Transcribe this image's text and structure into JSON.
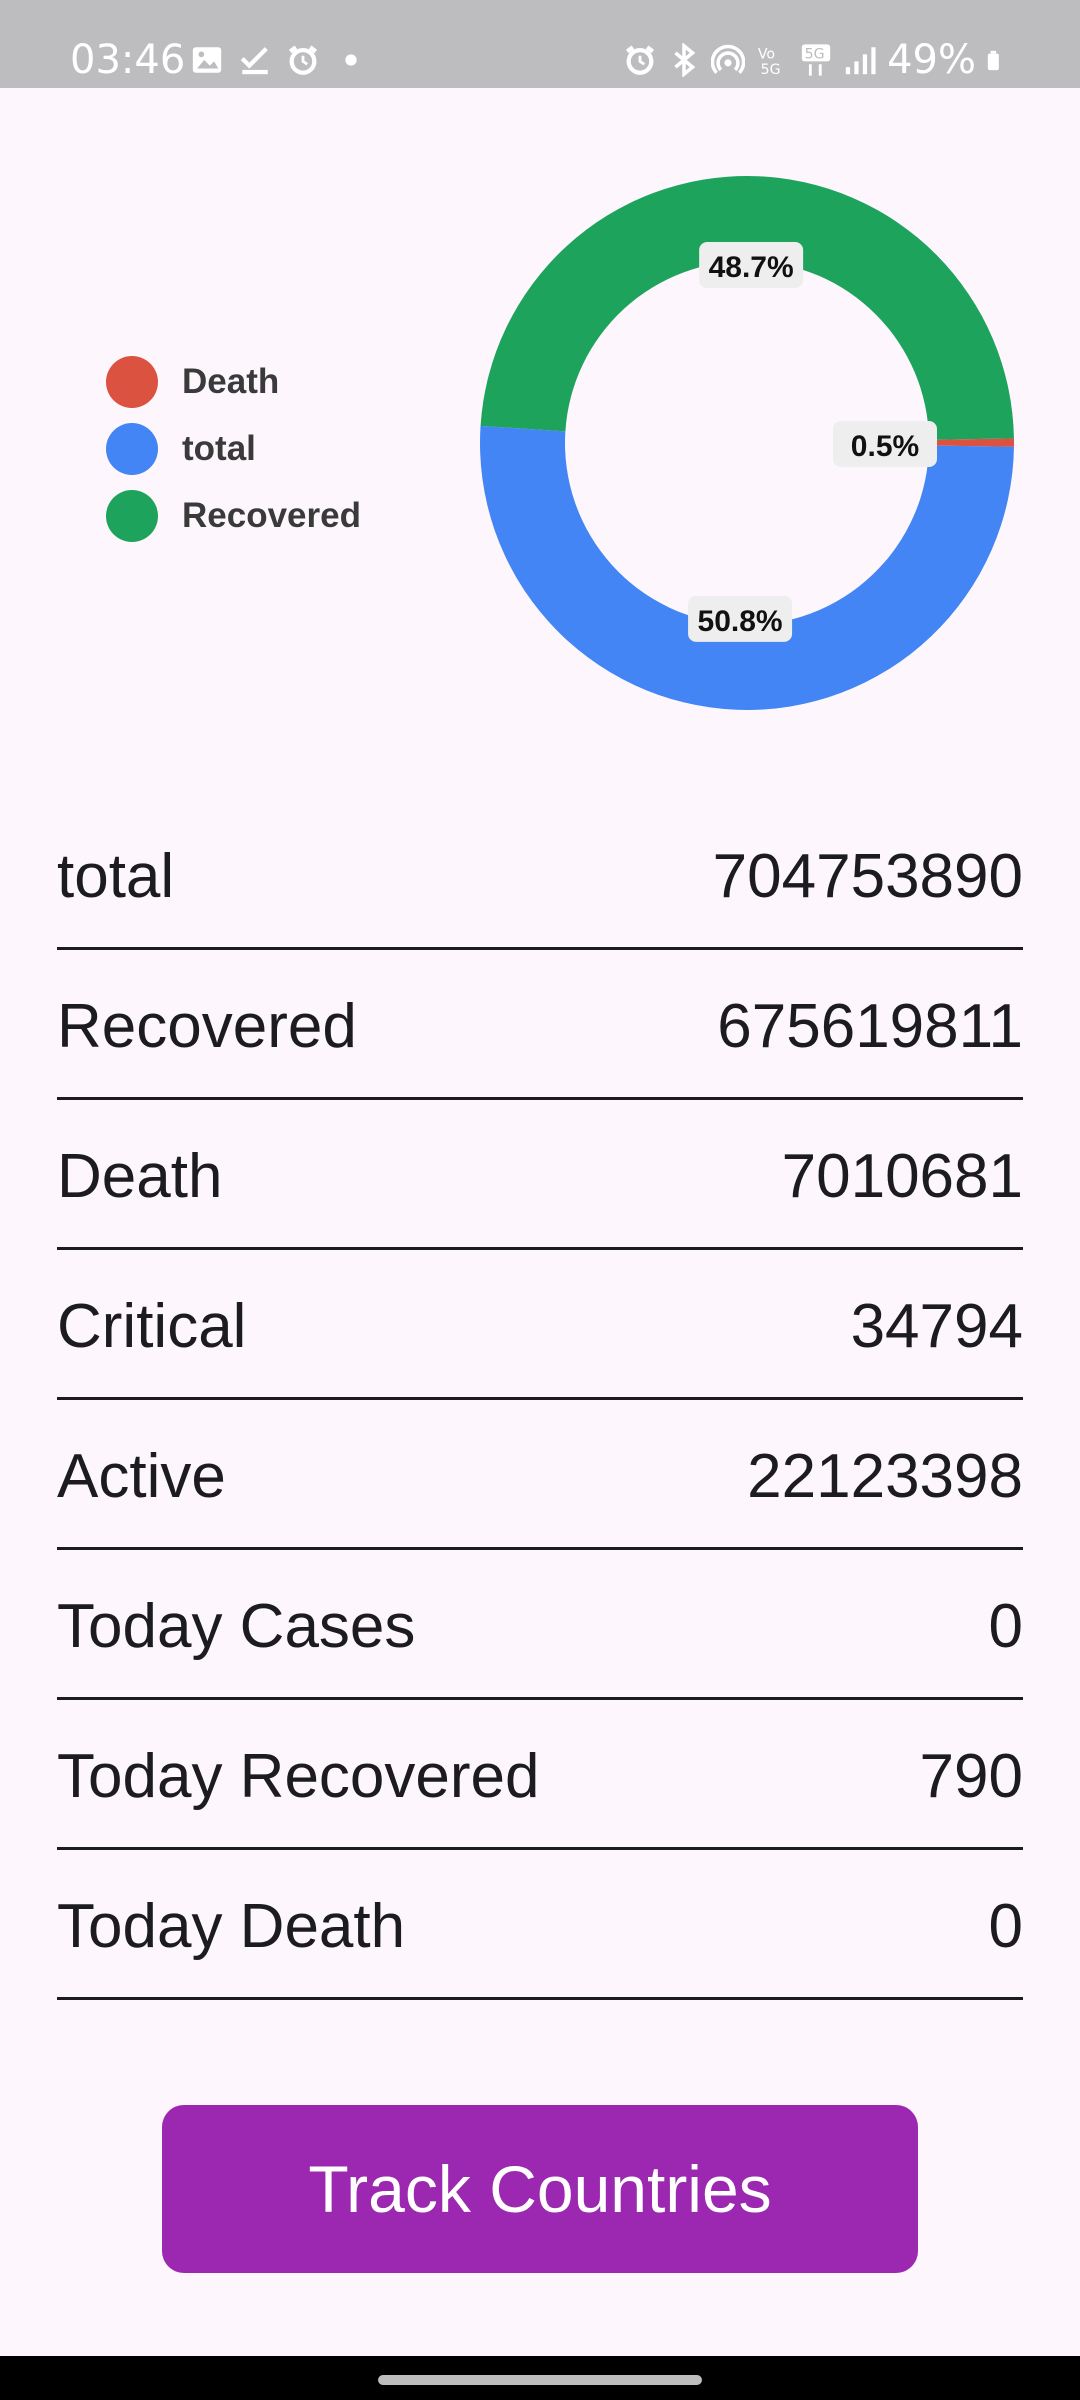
{
  "status_bar": {
    "time": "03:46",
    "battery": "49%",
    "left_icons": [
      "image-icon",
      "check-icon",
      "alarm-icon",
      "dot-icon"
    ],
    "right_icons": [
      "alarm-icon",
      "bluetooth-icon",
      "hotspot-icon",
      "volte-icon",
      "5g-icon",
      "signal-icon",
      "battery-icon"
    ]
  },
  "chart_data": {
    "type": "pie",
    "donut": true,
    "legend_position": "left",
    "series": [
      {
        "name": "Death",
        "value": 0.5,
        "label": "0.5%",
        "color": "#dc5241"
      },
      {
        "name": "total",
        "value": 50.8,
        "label": "50.8%",
        "color": "#4385f4"
      },
      {
        "name": "Recovered",
        "value": 48.7,
        "label": "48.7%",
        "color": "#1ea35d"
      }
    ]
  },
  "stats": [
    {
      "label": "total",
      "value": "704753890"
    },
    {
      "label": "Recovered",
      "value": "675619811"
    },
    {
      "label": "Death",
      "value": "7010681"
    },
    {
      "label": "Critical",
      "value": "34794"
    },
    {
      "label": "Active",
      "value": "22123398"
    },
    {
      "label": "Today Cases",
      "value": "0"
    },
    {
      "label": "Today Recovered",
      "value": "790"
    },
    {
      "label": "Today Death",
      "value": "0"
    }
  ],
  "button": {
    "label": "Track Countries",
    "color": "#9c27b0"
  }
}
